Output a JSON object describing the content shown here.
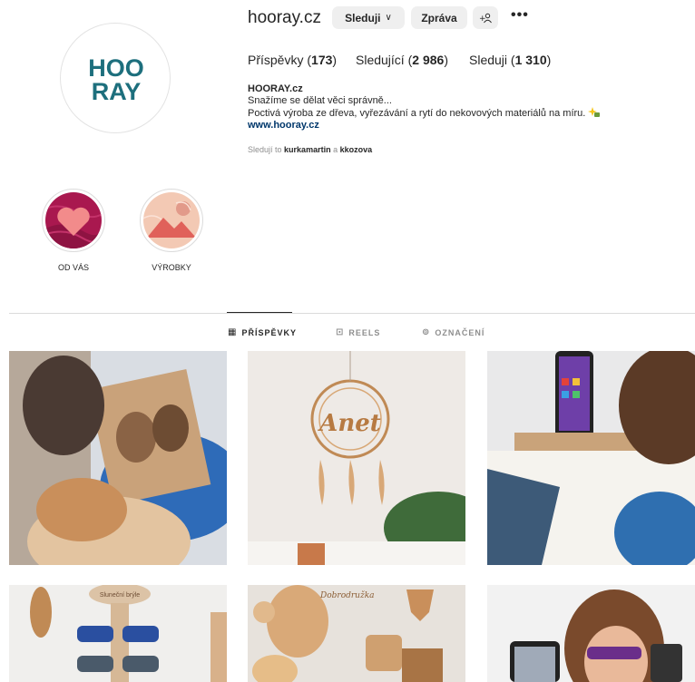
{
  "profile": {
    "username": "hooray.cz",
    "follow_label": "Sleduji",
    "message_label": "Zpráva",
    "add_user_label": "+ ⚲",
    "more_label": "•••",
    "logo_line1": "HOO",
    "logo_line2": "RAY",
    "stats": {
      "posts_label": "Příspěvky",
      "posts_count": "173",
      "followers_label": "Sledující",
      "followers_count": "2 986",
      "following_label": "Sleduji",
      "following_count": "1 310"
    },
    "bio": {
      "name": "HOORAY.cz",
      "line1": "Snažíme se dělat věci správně...",
      "line2": "Poctivá výroba ze dřeva, vyřezávání a rytí do nekovových materiálů na míru.",
      "link": "www.hooray.cz"
    },
    "followed_by": {
      "prefix": "Sledují to",
      "user1": "kurkamartin",
      "joiner": "a",
      "user2": "kkozova"
    }
  },
  "highlights": [
    {
      "label": "OD VÁS",
      "icon": "heart-icon"
    },
    {
      "label": "VÝROBKY",
      "icon": "mountain-icon"
    }
  ],
  "tabs": [
    {
      "label": "PŘÍSPĚVKY",
      "icon": "grid-icon",
      "active": true
    },
    {
      "label": "REELS",
      "icon": "reels-icon",
      "active": false
    },
    {
      "label": "OZNAČENÍ",
      "icon": "tag-icon",
      "active": false
    }
  ],
  "posts": [
    {
      "name": "post-engraved-portrait",
      "overlay_text": ""
    },
    {
      "name": "post-dreamcatcher",
      "overlay_text": "Anet"
    },
    {
      "name": "post-phone-stand",
      "overlay_text": ""
    },
    {
      "name": "post-sunglasses-stand",
      "overlay_text": "Sluneční brýle"
    },
    {
      "name": "post-wooden-decor",
      "overlay_text": "Dobrodružka"
    },
    {
      "name": "post-woman-phone",
      "overlay_text": ""
    }
  ],
  "colors": {
    "logo_teal": "#1d6f7d",
    "button_bg": "#efefef",
    "link_blue": "#00376b",
    "muted": "#8e8e8e",
    "divider": "#dbdbdb"
  }
}
